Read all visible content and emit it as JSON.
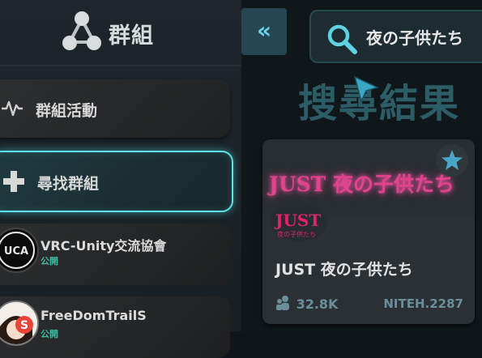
{
  "sidebar": {
    "title": "群組",
    "nav": [
      {
        "label": "群組活動",
        "icon": "activity-icon"
      },
      {
        "label": "尋找群組",
        "icon": "plus-icon"
      }
    ],
    "groups": [
      {
        "name": "VRC-Unity交流協會",
        "status": "公開",
        "avatar_text": "UCA"
      },
      {
        "name": "FreeDomTrailS",
        "status": "公開",
        "avatar_text": "S"
      }
    ]
  },
  "main": {
    "collapse_label": "«",
    "search": {
      "value": "夜の子供たち"
    },
    "results_title": "搜尋結果",
    "card": {
      "banner_text": "JUST 夜の子供たち",
      "thumb_title": "JUST",
      "thumb_subtitle": "夜の子供たち",
      "name": "JUST 夜の子供たち",
      "members": "32.8K",
      "code": "NITEH.2287"
    }
  },
  "colors": {
    "accent": "#5fe0ea",
    "public_status": "#3fbfa9",
    "neon_pink": "#e0448d",
    "results_title": "#2c5c66"
  }
}
